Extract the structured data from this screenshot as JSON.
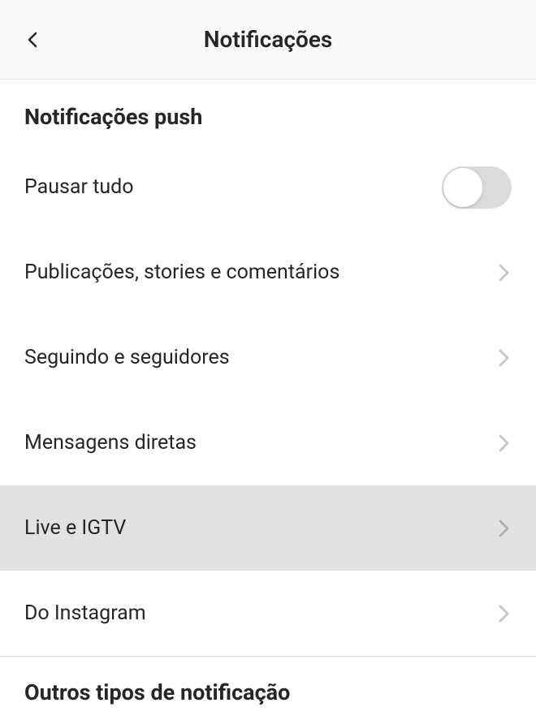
{
  "header": {
    "title": "Notificações"
  },
  "sections": {
    "push": {
      "title": "Notificações push",
      "pause_all": "Pausar tudo",
      "pause_all_enabled": false,
      "items": [
        "Publicações, stories e comentários",
        "Seguindo e seguidores",
        "Mensagens diretas",
        "Live e IGTV",
        "Do Instagram"
      ]
    },
    "other": {
      "title": "Outros tipos de notificação"
    }
  },
  "colors": {
    "text_primary": "#262626",
    "border": "#dbdbdb",
    "header_bg": "#fafafa",
    "row_highlight": "#e2e2e2",
    "chevron": "#c7c7cc"
  }
}
